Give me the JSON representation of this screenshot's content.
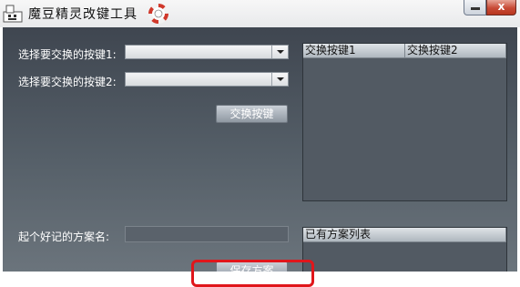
{
  "window": {
    "title": "魔豆精灵改键工具",
    "icons": [
      "app-icon",
      "help-lifebuoy-icon",
      "minimize-icon",
      "close-icon"
    ],
    "close_glyph": "x"
  },
  "form": {
    "key1_label": "选择要交换的按键1:",
    "key1_value": "",
    "key2_label": "选择要交换的按键2:",
    "key2_value": "",
    "swap_button": "交换按键",
    "scheme_name_label": "起个好记的方案名:",
    "scheme_name_value": "",
    "save_button": "保存方案"
  },
  "swap_table": {
    "columns": [
      "交换按键1",
      "交换按键2"
    ],
    "rows": []
  },
  "scheme_list": {
    "header": "已有方案列表",
    "items": []
  },
  "colors": {
    "panel_top": "#3f4650",
    "panel_bottom": "#6b747c",
    "highlight": "#e0161b"
  }
}
